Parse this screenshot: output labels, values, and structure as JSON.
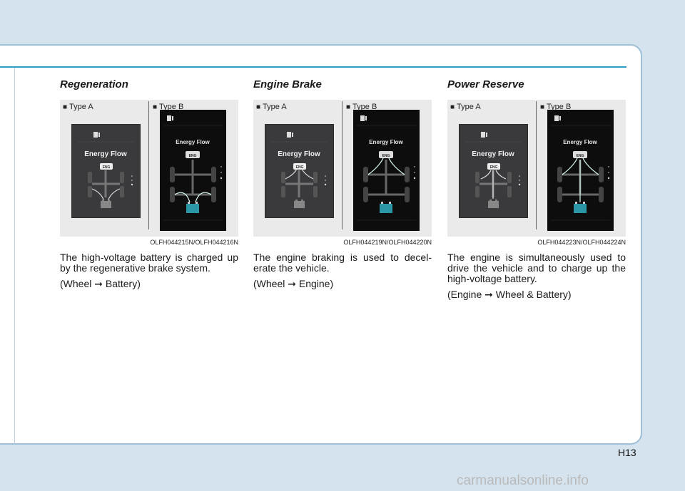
{
  "page_number": "H13",
  "watermark": "carmanualsonline.info",
  "type_a_label": "Type A",
  "type_b_label": "Type B",
  "screen": {
    "title": "Energy Flow",
    "engine_label": "ENG"
  },
  "sections": [
    {
      "title": "Regeneration",
      "caption": "OLFH044215N/OLFH044216N",
      "body": "The high-voltage battery is charged up by the regenerative brake system.",
      "flow_open": "(Wheel ",
      "flow_arrow": "➞",
      "flow_close": " Battery)"
    },
    {
      "title": "Engine Brake",
      "caption": "OLFH044219N/OLFH044220N",
      "body": "The engine braking is used to decel-erate the vehicle.",
      "flow_open": "(Wheel ",
      "flow_arrow": "➞",
      "flow_close": " Engine)"
    },
    {
      "title": "Power Reserve",
      "caption": "OLFH044223N/OLFH044224N",
      "body": "The engine is simultaneously used to drive the vehicle and to charge up the high-voltage battery.",
      "flow_open": "(Engine ",
      "flow_arrow": "➞",
      "flow_close": " Wheel & Battery)"
    }
  ],
  "colors": {
    "accent_line": "#2b9ec7",
    "page_bg": "#d4e3ee",
    "battery_teal": "#2a96a6"
  }
}
